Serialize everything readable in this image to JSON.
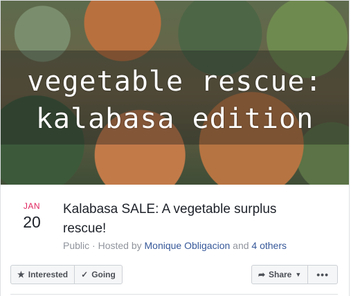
{
  "cover": {
    "line1": "vegetable rescue:",
    "line2": "kalabasa edition"
  },
  "event": {
    "month": "JAN",
    "day": "20",
    "title": "Kalabasa SALE: A vegetable surplus rescue!",
    "privacy": "Public",
    "hosted_by_prefix": "· Hosted by",
    "host": "Monique Obligacion",
    "and": "and",
    "others": "4 others"
  },
  "actions": {
    "interested": "Interested",
    "going": "Going",
    "share": "Share",
    "more": "•••"
  },
  "colors": {
    "date_month": "#e0245e",
    "link": "#365899",
    "meta": "#90949c"
  },
  "icons": {
    "interested": "star-icon",
    "going": "check-icon",
    "share": "share-arrow-icon",
    "dropdown": "caret-down-icon"
  }
}
